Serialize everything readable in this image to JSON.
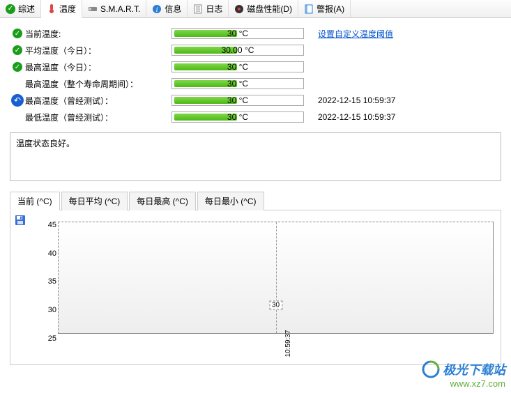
{
  "tabs": [
    {
      "label": "综述",
      "icon": "check"
    },
    {
      "label": "温度",
      "icon": "thermo"
    },
    {
      "label": "S.M.A.R.T.",
      "icon": "smart"
    },
    {
      "label": "信息",
      "icon": "info"
    },
    {
      "label": "日志",
      "icon": "log"
    },
    {
      "label": "磁盘性能(D)",
      "icon": "disk"
    },
    {
      "label": "警报(A)",
      "icon": "alert"
    }
  ],
  "active_tab": 1,
  "readings": [
    {
      "label": "当前温度:",
      "value": "30 °C",
      "status": "ok",
      "extra_link": "设置自定义温度阈值"
    },
    {
      "label": "平均温度（今日）：",
      "value": "30.00 °C",
      "status": "ok"
    },
    {
      "label": "最高温度（今日）：",
      "value": "30 °C",
      "status": "ok"
    },
    {
      "label": "最高温度（整个寿命周期间）：",
      "value": "30 °C",
      "status": "none"
    },
    {
      "label": "最高温度（曾经测试）：",
      "value": "30 °C",
      "status": "back",
      "extra": "2022-12-15 10:59:37"
    },
    {
      "label": "最低温度（曾经测试）：",
      "value": "30 °C",
      "status": "none",
      "extra": "2022-12-15 10:59:37"
    }
  ],
  "status_text": "温度状态良好。",
  "sub_tabs": [
    "当前 (^C)",
    "每日平均 (^C)",
    "每日最高 (^C)",
    "每日最小 (^C)"
  ],
  "active_sub_tab": 0,
  "chart_data": {
    "type": "line",
    "ylim": [
      25,
      45
    ],
    "yticks": [
      25,
      30,
      35,
      40,
      45
    ],
    "x_labels": [
      "10:59:37"
    ],
    "series": [
      {
        "name": "当前",
        "values": [
          30
        ]
      }
    ],
    "point_label": "30"
  },
  "watermark": {
    "brand": "极光下载站",
    "site": "www.xz7.com"
  }
}
